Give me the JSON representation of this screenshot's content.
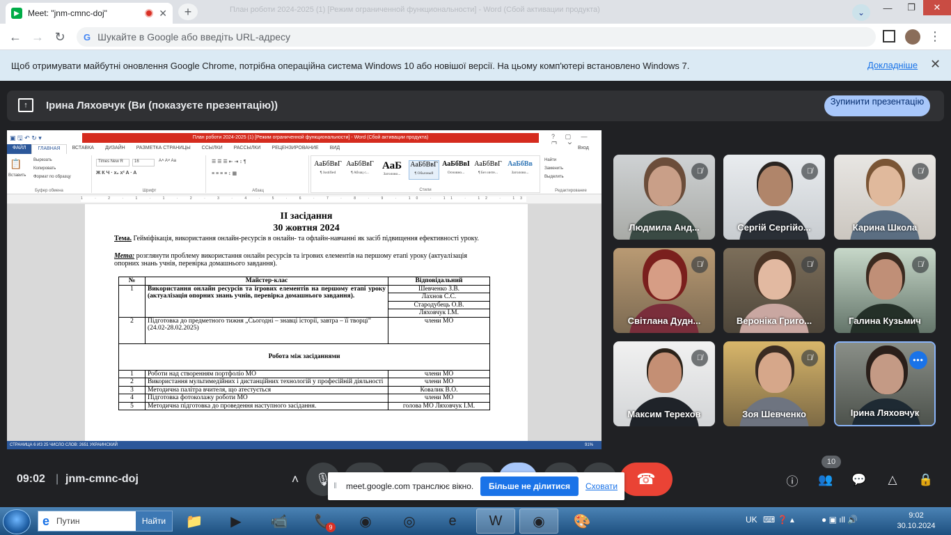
{
  "browser": {
    "tab_title": "Meet: \"jnm-cmnc-doj\"",
    "ghost_tabs": "План роботи 2024-2025 (1) [Режим ограниченной функциональности] - Word (Сбой активации продукта)",
    "address_placeholder": "Шукайте в Google або введіть URL-адресу",
    "info_message": "Щоб отримувати майбутні оновлення Google Chrome, потрібна операційна система Windows 10 або новішої версії. На цьому комп'ютері встановлено Windows 7.",
    "info_link": "Докладніше"
  },
  "meet": {
    "presenting_title": "Ірина Ляховчук (Ви (показуєте презентацію))",
    "stop_presenting": "Зупинити презентацію",
    "time": "09:02",
    "separator": "|",
    "meeting_code": "jnm-cmnc-doj",
    "people_count": "10",
    "share_notice": "meet.google.com транслює вікно.",
    "share_stop": "Більше не ділитися",
    "share_hide": "Сховати",
    "participants": [
      {
        "name": "Людмила Анд..."
      },
      {
        "name": "Сергій Сергійо..."
      },
      {
        "name": "Карина Школа"
      },
      {
        "name": "Світлана Дудн..."
      },
      {
        "name": "Вероніка Григо..."
      },
      {
        "name": "Галина Кузьмич"
      },
      {
        "name": "Максим Терехов"
      },
      {
        "name": "Зоя Шевченко"
      },
      {
        "name": "Ірина Ляховчук"
      }
    ]
  },
  "word": {
    "title": "План роботи 2024-2025 (1) [Режим ограниченной функциональности] - Word (Сбой активации продукта)",
    "tabs": [
      "ФАЙЛ",
      "ГЛАВНАЯ",
      "ВСТАВКА",
      "ДИЗАЙН",
      "РАЗМЕТКА СТРАНИЦЫ",
      "ССЫЛКИ",
      "РАССЫЛКИ",
      "РЕЦЕНЗИРОВАНИЕ",
      "ВИД"
    ],
    "login": "Вход",
    "clipboard": {
      "paste": "Вставить",
      "cut": "Вырезать",
      "copy": "Копировать",
      "format": "Формат по образцу",
      "label": "Буфер обмена"
    },
    "font": {
      "name": "Times New R",
      "size": "16",
      "label": "Шрифт"
    },
    "paragraph_label": "Абзац",
    "styles": [
      {
        "sample": "АаБбВвГ",
        "name": "¶ Justified"
      },
      {
        "sample": "АаБбВвГ",
        "name": "¶ Абзац с..."
      },
      {
        "sample": "АаБ",
        "name": "Заголово..."
      },
      {
        "sample": "АаБбВвГ",
        "name": "¶ Обычный"
      },
      {
        "sample": "АаБбВвІ",
        "name": "Основно..."
      },
      {
        "sample": "АаБбВвГ",
        "name": "¶ Без инте..."
      },
      {
        "sample": "АаБбВв",
        "name": "Заголово..."
      }
    ],
    "styles_label": "Стили",
    "editing": {
      "find": "Найти",
      "replace": "Заменить",
      "select": "Выделить",
      "label": "Редактирование"
    },
    "ruler": "1 · 2 · 1 · 1 · 2 · 3 · 4 · 5 · 6 · 7 · 8 · 9 · 10 · 11 · 12 · 13 · 14 · 15 · 16 · 17 · 18 · 19 · 20 · 21 · 22 · 23 · 24 · 25 · 26 · 27",
    "status": "СТРАНИЦА 6 ИЗ 25    ЧИСЛО СЛОВ: 2651    УКРАИНСКИЙ",
    "zoom": "91%",
    "document": {
      "heading1": "ІІ засідання",
      "heading2": "30 жовтня 2024",
      "tema_label": "Тема.",
      "tema_text": " Гейміфікація, використання  онлайн-ресурсів в онлайн- та офлайн-навчанні як засіб підвищення ефективності уроку.",
      "meta_label": "Мета:",
      "meta_text": " розглянути проблему використання онлайн ресурсів та ігрових елементів на першому етапі уроку (актуалізація опорних знань учнів, перевірка домашнього завдання).",
      "table": {
        "headers": [
          "№",
          "Майстер-клас",
          "Відповідальний"
        ],
        "row1": {
          "num": "1",
          "text": "Використання онлайн ресурсів та ігрових елементів на першому етапі уроку (актуалізація опорних знань учнів, перевірка домашнього завдання).",
          "resp": [
            "Шевченко З.В.",
            "Лахнов С.С.",
            "Стародубець О.В.",
            "Ляховчук І.М."
          ]
        },
        "row2": {
          "num": "2",
          "text": "Підготовка до предметного тижня „Сьогодні – знавці історії, завтра – її творці” (24.02-28.02.2025)",
          "resp": "члени МО"
        },
        "section": "Робота між засіданнями",
        "rows": [
          {
            "num": "1",
            "text": "Роботи над створенням портфоліо МО",
            "resp": "члени МО"
          },
          {
            "num": "2",
            "text": "Використання мультимедійних і дистанційних технологій у професійній діяльності",
            "resp": "члени МО"
          },
          {
            "num": "3",
            "text": "Методична палітра вчителя, що атестується",
            "resp": "Ковалик В.О."
          },
          {
            "num": "4",
            "text": "Підготовка фотоколажу роботи МО",
            "resp": "члени МО"
          },
          {
            "num": "5",
            "text": "Методична підготовка до проведення наступного засідання.",
            "resp": "голова МО Ляховчук І.М."
          }
        ]
      }
    }
  },
  "taskbar": {
    "search_placeholder": "Путин",
    "search_go": "Найти",
    "viber_badge": "9",
    "lang": "UK",
    "time": "9:02",
    "date": "30.10.2024"
  },
  "colors": {
    "meet_bg": "#202124",
    "accent_blue": "#1a73e8",
    "stop_btn": "#a8c7fa",
    "hangup": "#ea4335",
    "word_blue": "#2b579a",
    "word_red_bar": "#d52b1e"
  }
}
